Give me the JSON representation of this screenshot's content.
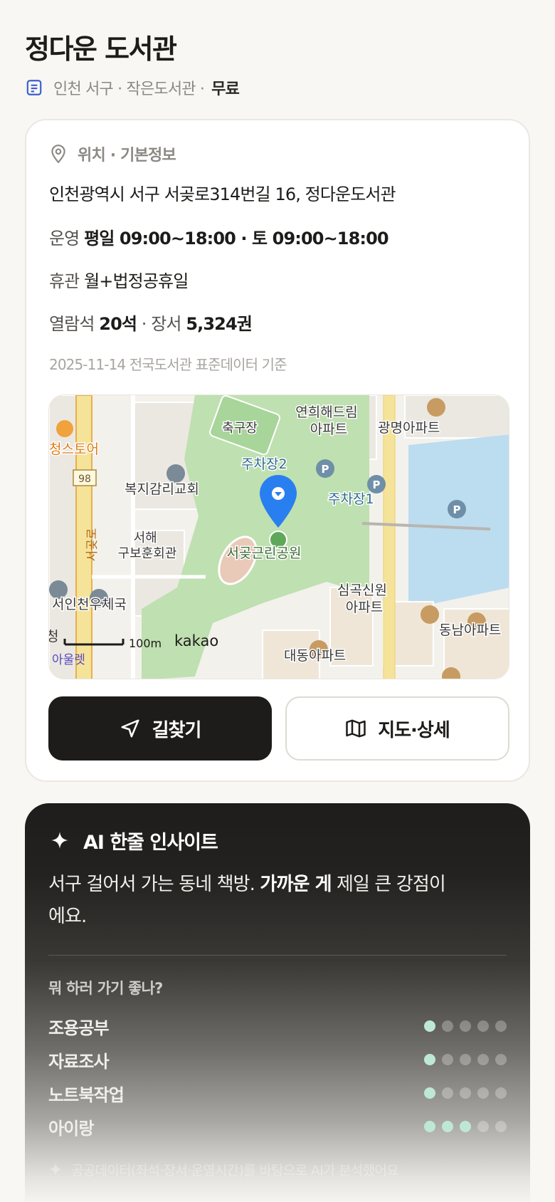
{
  "title": "정다운 도서관",
  "meta": {
    "icon": "document-icon",
    "location_type": "인천 서구 · 작은도서관 ·",
    "price": "무료"
  },
  "info": {
    "section_icon": "location-pin-icon",
    "section_title": "위치 · 기본정보",
    "address": "인천광역시 서구 서곶로314번길 16, 정다운도서관",
    "hours_label": "운영",
    "hours_value": "평일 09:00~18:00 · 토 09:00~18:00",
    "closed_label": "휴관",
    "closed_value": "월+법정공휴일",
    "seats_label": "열람석",
    "seats_value": "20석",
    "books_label": "· 장서",
    "books_value": "5,324권",
    "source": "2025-11-14 전국도서관 표준데이터 기준"
  },
  "map": {
    "labels": {
      "store": "청스토어",
      "road_num": "98",
      "church": "복지감리교회",
      "road_name": "서곶로",
      "veterans": "서해\n구보훈회관",
      "post": "서인천우체국",
      "soccer": "축구장",
      "apt1": "연희해드림\n아파트",
      "apt2": "광명아파트",
      "parking2": "주차장2",
      "parking1": "주차장1",
      "park": "서곶근린공원",
      "apt3": "심곡신원\n아파트",
      "apt4": "동남아파트",
      "apt5": "대동아파트",
      "scale": "100m",
      "brand": "kakao",
      "edge1": "청",
      "edge2": "아울렛"
    },
    "colors": {
      "park": "#bfe0b0",
      "water": "#bcdcf0",
      "road": "#f6e39a",
      "pin": "#2a7ff0"
    }
  },
  "buttons": {
    "directions": "길찾기",
    "directions_icon": "navigation-arrow-icon",
    "map_detail": "지도·상세",
    "map_detail_icon": "map-icon"
  },
  "ai": {
    "icon": "sparkle-icon",
    "title": "AI 한줄 인사이트",
    "text_pre": "서구 걸어서 가는 동네 책방. ",
    "text_bold": "가까운 게",
    "text_post": " 제일 큰 강점이에요.",
    "question": "뭐 하러 가기 좋나?",
    "ratings": [
      {
        "label": "조용공부",
        "score": 1,
        "max": 5
      },
      {
        "label": "자료조사",
        "score": 1,
        "max": 5
      },
      {
        "label": "노트북작업",
        "score": 1,
        "max": 5
      },
      {
        "label": "아이랑",
        "score": 3,
        "max": 5
      }
    ],
    "footnote": "공공데이터(좌석·장서·운영시간)를 바탕으로 AI가 분석했어요"
  }
}
